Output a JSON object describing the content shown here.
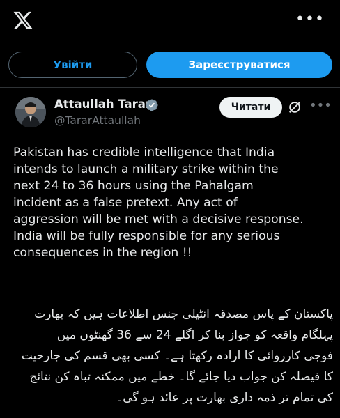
{
  "header": {
    "logo_icon": "x-logo-icon",
    "more_icon": "more-horizontal-icon"
  },
  "auth": {
    "login_label": "Увійти",
    "signup_label": "Зареєструватися"
  },
  "tweet": {
    "author_name": "Attaullah Tarar",
    "handle": "@TararAttaullah",
    "verified": true,
    "follow_label": "Читати",
    "text_en": "Pakistan has credible intelligence that India\nintends to launch a military strike within the\nnext 24 to 36 hours using the Pahalgam\nincident as a false pretext. Any act of\naggression will be met with a decisive response.\nIndia will be fully responsible for any serious\nconsequences in the region !!",
    "text_ur_lines": [
      "پاکستان کے پاس مصدقہ انٹیلی جنس اطلاعات ہیں کہ بھارت",
      "پہلگام واقعہ کو جواز بنا کر اگلے 24 سے 36 گھنٹوں میں",
      "فوجی کارروائی کا ارادہ رکھتا ہے۔ کسی بھی قسم کی جارحیت",
      "کا فیصلہ کن جواب دیا جائے گا۔ خطے میں ممکنہ تباہ کن نتائج",
      "کی تمام تر ذمہ داری بھارت پر عائد ہو گی۔"
    ]
  },
  "colors": {
    "background": "#000000",
    "accent": "#1d9bf0",
    "text": "#e7e9ea",
    "muted": "#71767b"
  }
}
